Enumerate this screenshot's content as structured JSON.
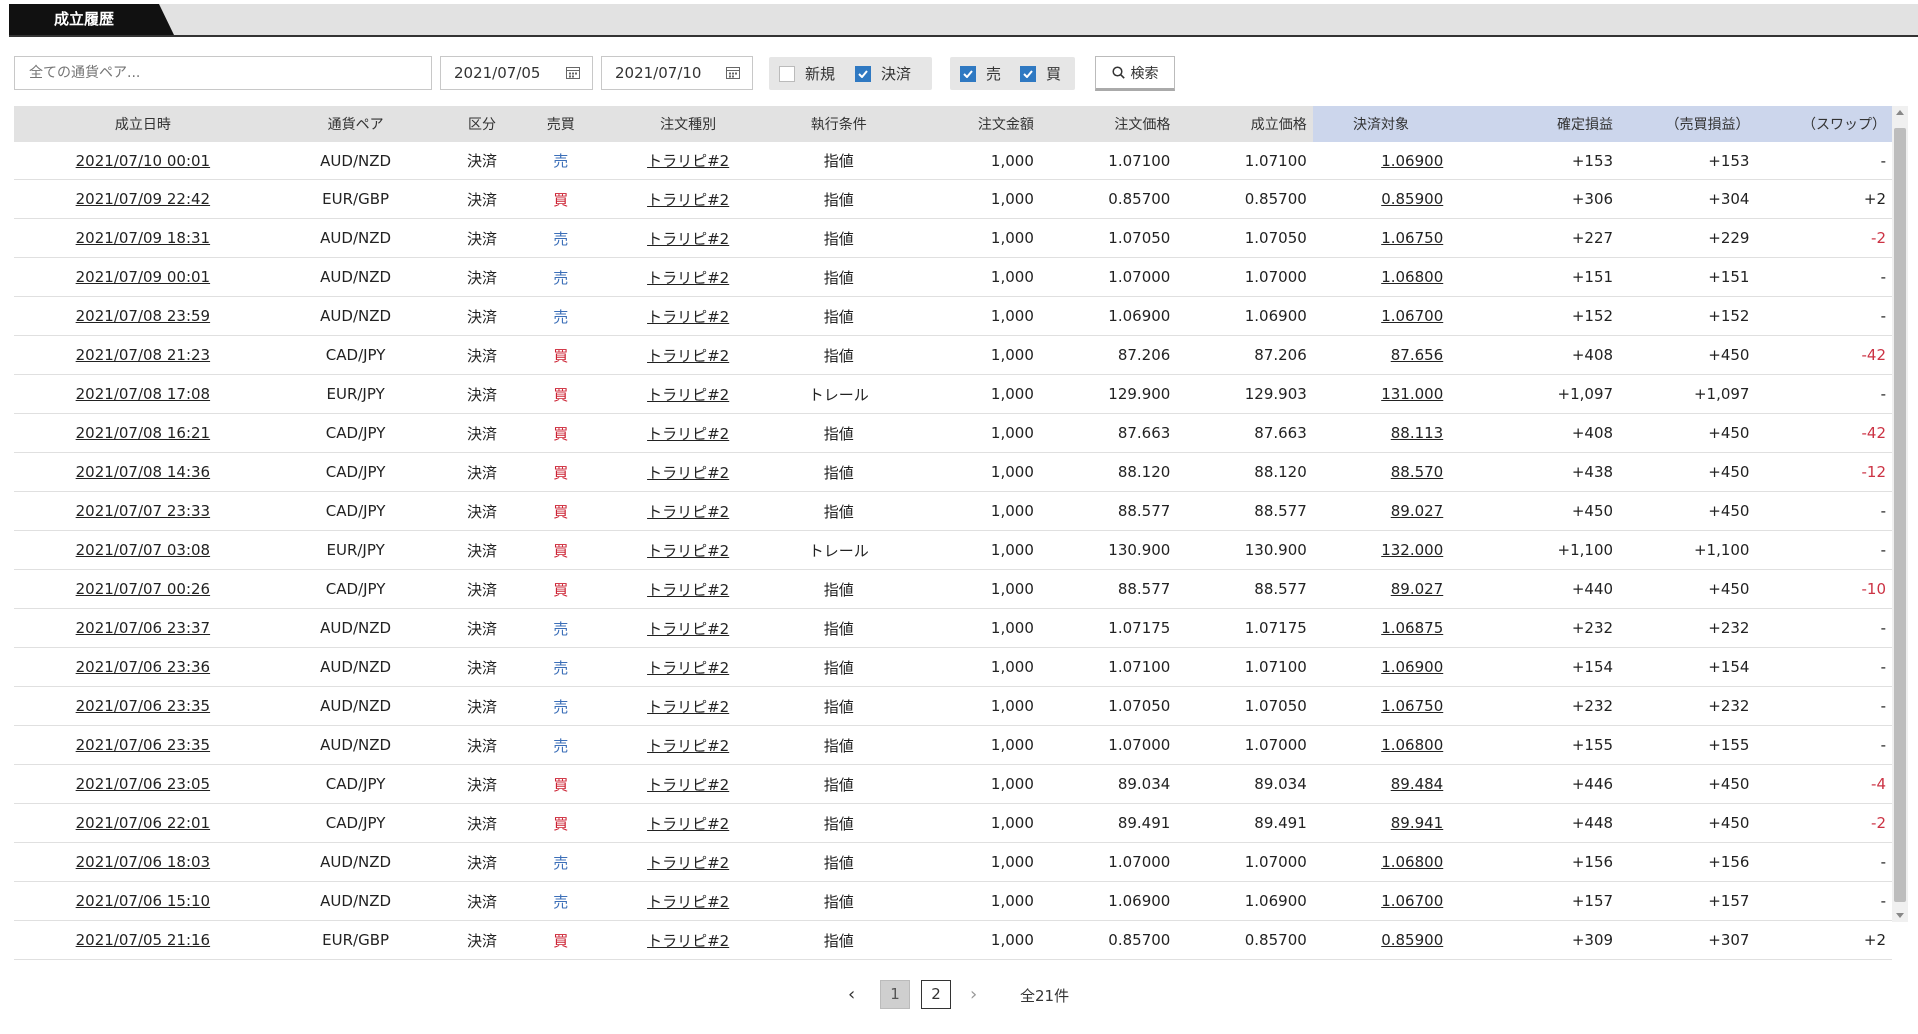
{
  "tab": {
    "label": "成立履歴"
  },
  "filters": {
    "pair_placeholder": "全ての通貨ペア...",
    "date_from": "2021/07/05",
    "date_to": "2021/07/10",
    "checkbox_new": {
      "label": "新規",
      "checked": false
    },
    "checkbox_settle": {
      "label": "決済",
      "checked": true
    },
    "checkbox_sell": {
      "label": "売",
      "checked": true
    },
    "checkbox_buy": {
      "label": "買",
      "checked": true
    },
    "search_label": "検索"
  },
  "table": {
    "headers": [
      "成立日時",
      "通貨ペア",
      "区分",
      "売買",
      "注文種別",
      "執行条件",
      "注文金額",
      "注文価格",
      "成立価格",
      "決済対象",
      "確定損益",
      "（売買損益）",
      "（スワップ）"
    ],
    "rows": [
      [
        "2021/07/10 00:01",
        "AUD/NZD",
        "決済",
        "売",
        "トラリピ#2",
        "指値",
        "1,000",
        "1.07100",
        "1.07100",
        "1.06900",
        "+153",
        "+153",
        "-"
      ],
      [
        "2021/07/09 22:42",
        "EUR/GBP",
        "決済",
        "買",
        "トラリピ#2",
        "指値",
        "1,000",
        "0.85700",
        "0.85700",
        "0.85900",
        "+306",
        "+304",
        "+2"
      ],
      [
        "2021/07/09 18:31",
        "AUD/NZD",
        "決済",
        "売",
        "トラリピ#2",
        "指値",
        "1,000",
        "1.07050",
        "1.07050",
        "1.06750",
        "+227",
        "+229",
        "-2"
      ],
      [
        "2021/07/09 00:01",
        "AUD/NZD",
        "決済",
        "売",
        "トラリピ#2",
        "指値",
        "1,000",
        "1.07000",
        "1.07000",
        "1.06800",
        "+151",
        "+151",
        "-"
      ],
      [
        "2021/07/08 23:59",
        "AUD/NZD",
        "決済",
        "売",
        "トラリピ#2",
        "指値",
        "1,000",
        "1.06900",
        "1.06900",
        "1.06700",
        "+152",
        "+152",
        "-"
      ],
      [
        "2021/07/08 21:23",
        "CAD/JPY",
        "決済",
        "買",
        "トラリピ#2",
        "指値",
        "1,000",
        "87.206",
        "87.206",
        "87.656",
        "+408",
        "+450",
        "-42"
      ],
      [
        "2021/07/08 17:08",
        "EUR/JPY",
        "決済",
        "買",
        "トラリピ#2",
        "トレール",
        "1,000",
        "129.900",
        "129.903",
        "131.000",
        "+1,097",
        "+1,097",
        "-"
      ],
      [
        "2021/07/08 16:21",
        "CAD/JPY",
        "決済",
        "買",
        "トラリピ#2",
        "指値",
        "1,000",
        "87.663",
        "87.663",
        "88.113",
        "+408",
        "+450",
        "-42"
      ],
      [
        "2021/07/08 14:36",
        "CAD/JPY",
        "決済",
        "買",
        "トラリピ#2",
        "指値",
        "1,000",
        "88.120",
        "88.120",
        "88.570",
        "+438",
        "+450",
        "-12"
      ],
      [
        "2021/07/07 23:33",
        "CAD/JPY",
        "決済",
        "買",
        "トラリピ#2",
        "指値",
        "1,000",
        "88.577",
        "88.577",
        "89.027",
        "+450",
        "+450",
        "-"
      ],
      [
        "2021/07/07 03:08",
        "EUR/JPY",
        "決済",
        "買",
        "トラリピ#2",
        "トレール",
        "1,000",
        "130.900",
        "130.900",
        "132.000",
        "+1,100",
        "+1,100",
        "-"
      ],
      [
        "2021/07/07 00:26",
        "CAD/JPY",
        "決済",
        "買",
        "トラリピ#2",
        "指値",
        "1,000",
        "88.577",
        "88.577",
        "89.027",
        "+440",
        "+450",
        "-10"
      ],
      [
        "2021/07/06 23:37",
        "AUD/NZD",
        "決済",
        "売",
        "トラリピ#2",
        "指値",
        "1,000",
        "1.07175",
        "1.07175",
        "1.06875",
        "+232",
        "+232",
        "-"
      ],
      [
        "2021/07/06 23:36",
        "AUD/NZD",
        "決済",
        "売",
        "トラリピ#2",
        "指値",
        "1,000",
        "1.07100",
        "1.07100",
        "1.06900",
        "+154",
        "+154",
        "-"
      ],
      [
        "2021/07/06 23:35",
        "AUD/NZD",
        "決済",
        "売",
        "トラリピ#2",
        "指値",
        "1,000",
        "1.07050",
        "1.07050",
        "1.06750",
        "+232",
        "+232",
        "-"
      ],
      [
        "2021/07/06 23:35",
        "AUD/NZD",
        "決済",
        "売",
        "トラリピ#2",
        "指値",
        "1,000",
        "1.07000",
        "1.07000",
        "1.06800",
        "+155",
        "+155",
        "-"
      ],
      [
        "2021/07/06 23:05",
        "CAD/JPY",
        "決済",
        "買",
        "トラリピ#2",
        "指値",
        "1,000",
        "89.034",
        "89.034",
        "89.484",
        "+446",
        "+450",
        "-4"
      ],
      [
        "2021/07/06 22:01",
        "CAD/JPY",
        "決済",
        "買",
        "トラリピ#2",
        "指値",
        "1,000",
        "89.491",
        "89.491",
        "89.941",
        "+448",
        "+450",
        "-2"
      ],
      [
        "2021/07/06 18:03",
        "AUD/NZD",
        "決済",
        "売",
        "トラリピ#2",
        "指値",
        "1,000",
        "1.07000",
        "1.07000",
        "1.06800",
        "+156",
        "+156",
        "-"
      ],
      [
        "2021/07/06 15:10",
        "AUD/NZD",
        "決済",
        "売",
        "トラリピ#2",
        "指値",
        "1,000",
        "1.06900",
        "1.06900",
        "1.06700",
        "+157",
        "+157",
        "-"
      ],
      [
        "2021/07/05 21:16",
        "EUR/GBP",
        "決済",
        "買",
        "トラリピ#2",
        "指値",
        "1,000",
        "0.85700",
        "0.85700",
        "0.85900",
        "+309",
        "+307",
        "+2"
      ]
    ]
  },
  "pagination": {
    "prev": "‹",
    "page1": "1",
    "page2": "2",
    "next": "›",
    "total": "全21件"
  },
  "colors": {
    "sell": "#3c6fb8",
    "buy": "#cc2233",
    "negative_swap": "#cc3344",
    "checkbox_on": "#2f79c2",
    "header_highlight": "#ccd6ec"
  }
}
